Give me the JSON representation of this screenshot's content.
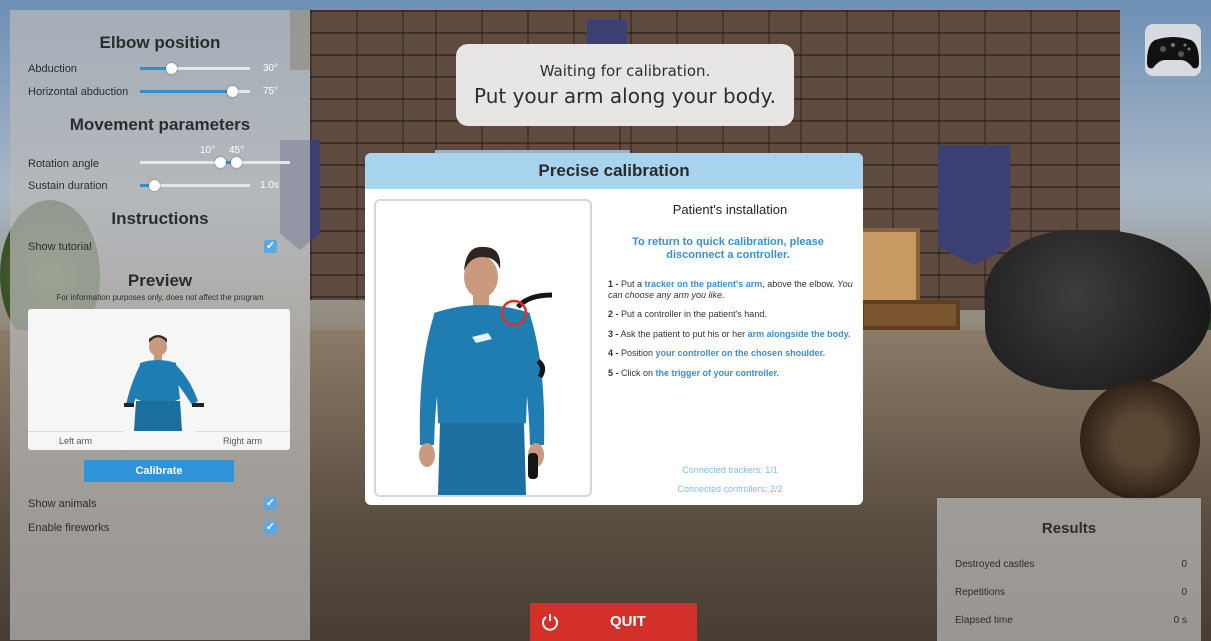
{
  "top_message": {
    "line1": "Waiting for calibration.",
    "line2": "Put your arm along your body."
  },
  "controller_icon": "gamepad-icon",
  "left_panel": {
    "elbow_title": "Elbow position",
    "abduction_label": "Abduction",
    "abduction_value": "30°",
    "abduction_level": 0.3,
    "horizontal_label": "Horizontal abduction",
    "horizontal_value": "75°",
    "horizontal_level": 0.75,
    "movement_title": "Movement parameters",
    "rotation_label": "Rotation angle",
    "rotation_min_value": "10°",
    "rotation_max_value": "45°",
    "sustain_label": "Sustain duration",
    "sustain_value": "1.0s",
    "sustain_level": 0.1,
    "instructions_title": "Instructions",
    "show_tutorial_label": "Show tutorial",
    "preview_title": "Preview",
    "preview_note": "For information purposes only, does not affect the program",
    "left_arm_label": "Left arm",
    "right_arm_label": "Right arm",
    "calibrate_label": "Calibrate",
    "show_animals_label": "Show animals",
    "enable_fireworks_label": "Enable fireworks",
    "checkbox_mark": "✓"
  },
  "modal": {
    "title": "Precise calibration",
    "installation_title": "Patient's installation",
    "return_note": "To return to quick calibration, please disconnect a controller.",
    "steps": [
      {
        "num": "1 -",
        "a": " Put a ",
        "hl": "tracker on the patient's arm",
        "b": ", above the elbow. ",
        "it": "You can choose any arm you like."
      },
      {
        "num": "2 -",
        "a": " Put a controller in the patient's hand.",
        "hl": "",
        "b": "",
        "it": ""
      },
      {
        "num": "3 -",
        "a": " Ask the patient to put his or her ",
        "hl": "arm alongside the body",
        "b": ".",
        "it": ""
      },
      {
        "num": "4 -",
        "a": " Position  ",
        "hl": "your controller on the chosen shoulder",
        "b": ".",
        "it": ""
      },
      {
        "num": "5 -",
        "a": " Click on ",
        "hl": "the trigger of your controller",
        "b": ".",
        "it": ""
      }
    ],
    "connected_trackers": "Connected trackers: 1/1",
    "connected_controllers": "Connected controllers: 2/2"
  },
  "results": {
    "title": "Results",
    "rows": [
      {
        "label": "Destroyed castles",
        "value": "0"
      },
      {
        "label": "Repetitions",
        "value": "0"
      },
      {
        "label": "Elapsed time",
        "value": "0 s"
      }
    ]
  },
  "quit": {
    "label": "QUIT",
    "icon": "power-icon"
  },
  "colors": {
    "accent": "#2f93d9",
    "modal_header": "#a8d4ee",
    "quit": "#d3302a"
  }
}
